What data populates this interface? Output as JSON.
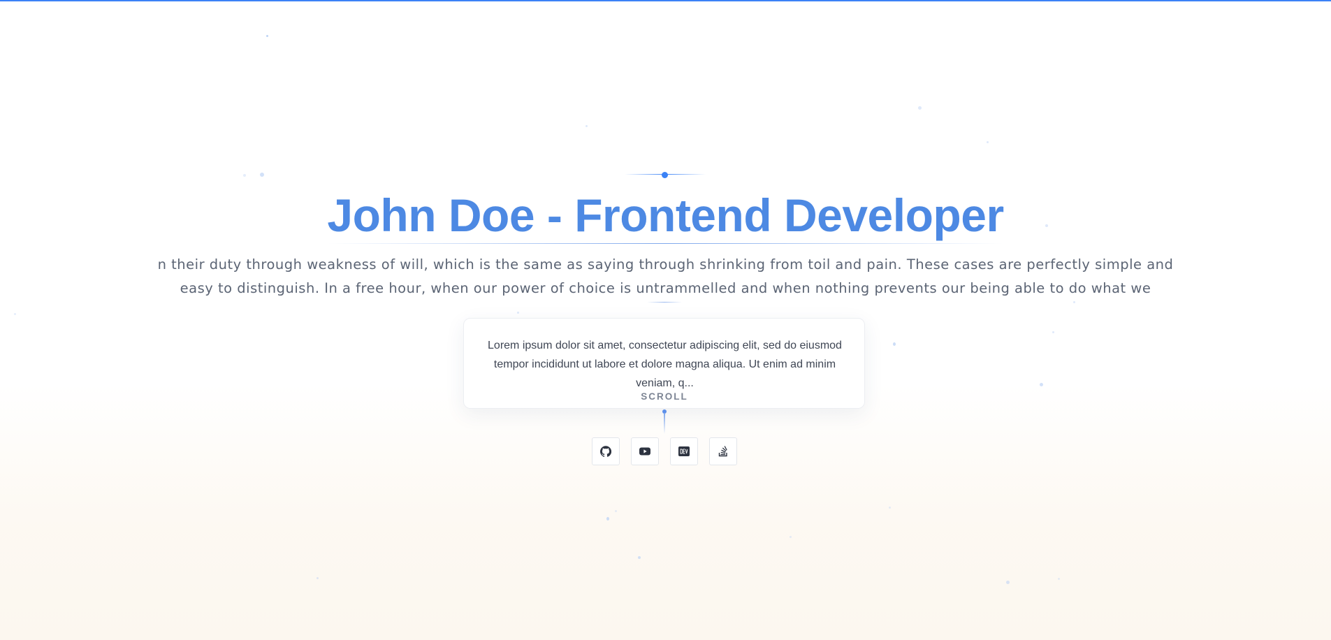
{
  "hero": {
    "title": "John Doe - Frontend Developer",
    "subtitle_line1": "n their duty through weakness of will, which is the same as saying through shrinking from toil and pain. These cases are perfectly simple and",
    "subtitle_line2": "easy to distinguish. In a free hour, when our power of choice is untrammelled and when nothing prevents our being able to do what we"
  },
  "card": {
    "text": "Lorem ipsum dolor sit amet, consectetur adipiscing elit, sed do eiusmod tempor incididunt ut labore et dolore magna aliqua. Ut enim ad minim veniam, q..."
  },
  "scroll": {
    "label": "SCROLL"
  },
  "social_links": [
    {
      "icon": "github-icon"
    },
    {
      "icon": "youtube-icon"
    },
    {
      "icon": "dev-icon"
    },
    {
      "icon": "stackoverflow-icon"
    }
  ],
  "colors": {
    "accent": "#3b82f6",
    "title": "#4d89e3",
    "text": "#5b6474",
    "icon": "#2d3340"
  }
}
